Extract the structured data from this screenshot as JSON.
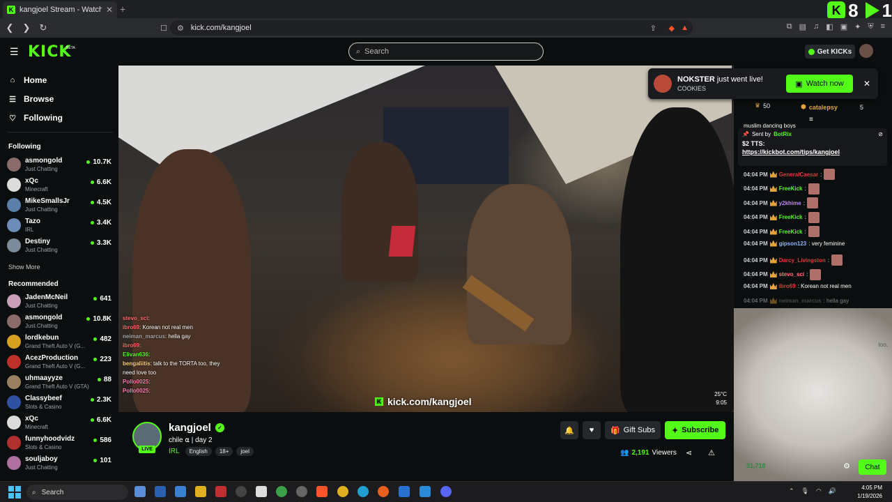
{
  "browser": {
    "tab_title": "kangjoel Stream - Watch Live",
    "tab_close": "✕",
    "new_tab": "+",
    "url": "kick.com/kangjoel",
    "overlay_counter": [
      "8",
      "1"
    ]
  },
  "header": {
    "logo": "KICK",
    "beta": "BETA",
    "search_placeholder": "Search",
    "get_kicks": "Get KICKs"
  },
  "sidebar": {
    "nav": [
      {
        "label": "Home",
        "icon": "⌂"
      },
      {
        "label": "Browse",
        "icon": "☰"
      },
      {
        "label": "Following",
        "icon": "♡"
      }
    ],
    "following_title": "Following",
    "following": [
      {
        "name": "asmongold",
        "category": "Just Chatting",
        "viewers": "10.7K",
        "color": "#8b6a6a"
      },
      {
        "name": "xQc",
        "category": "Minecraft",
        "viewers": "6.6K",
        "color": "#dcdcdc"
      },
      {
        "name": "MikeSmallsJr",
        "category": "Just Chatting",
        "viewers": "4.5K",
        "color": "#5a7fa8"
      },
      {
        "name": "Tazo",
        "category": "IRL",
        "viewers": "3.4K",
        "color": "#6b8db8"
      },
      {
        "name": "Destiny",
        "category": "Just Chatting",
        "viewers": "3.3K",
        "color": "#7a8a99"
      }
    ],
    "show_more": "Show More",
    "recommended_title": "Recommended",
    "recommended": [
      {
        "name": "JadenMcNeil",
        "category": "Just Chatting",
        "viewers": "641",
        "color": "#c9a0b8"
      },
      {
        "name": "asmongold",
        "category": "Just Chatting",
        "viewers": "10.8K",
        "color": "#8b6a6a"
      },
      {
        "name": "lordkebun",
        "category": "Grand Theft Auto V (G...",
        "viewers": "482",
        "color": "#d6a020"
      },
      {
        "name": "AcezProduction",
        "category": "Grand Theft Auto V (G...",
        "viewers": "223",
        "color": "#c0302a"
      },
      {
        "name": "uhmaayyze",
        "category": "Grand Theft Auto V (GTA)",
        "viewers": "88",
        "color": "#9a8060"
      },
      {
        "name": "Classybeef",
        "category": "Slots & Casino",
        "viewers": "2.3K",
        "color": "#3050a0"
      },
      {
        "name": "xQc",
        "category": "Minecraft",
        "viewers": "6.6K",
        "color": "#dcdcdc"
      },
      {
        "name": "funnyhoodvidz",
        "category": "Slots & Casino",
        "viewers": "586",
        "color": "#b03030"
      },
      {
        "name": "souljaboy",
        "category": "Just Chatting",
        "viewers": "101",
        "color": "#b070a0"
      }
    ]
  },
  "video": {
    "watermark": "kick.com/kangjoel",
    "overlay_chat": [
      {
        "user": "stevo_sci",
        "text": ":",
        "color": "#ff6a6a"
      },
      {
        "user": "ibro69",
        "text": ": Korean not real men",
        "color": "#ff6a6a"
      },
      {
        "user": "neiman_marcus",
        "text": ": hella gay",
        "color": "#aaaaaa"
      },
      {
        "user": "ibro69",
        "text": ":",
        "color": "#ff6a6a"
      },
      {
        "user": "Elivan636",
        "text": ":",
        "color": "#53fc18"
      },
      {
        "user": "bengaliitis",
        "text": ": talk to the TORTA too, they",
        "color": "#ffd27a"
      },
      {
        "user": "",
        "text": "need love too",
        "color": "#ffffff"
      },
      {
        "user": "Pollo0025",
        "text": ":",
        "color": "#ff7ab0"
      },
      {
        "user": "Pollo0025",
        "text": ":",
        "color": "#ff7ab0"
      }
    ],
    "temp": "25°C",
    "time": "9:05"
  },
  "notification": {
    "name": "NOKSTER",
    "text": " just went live!",
    "category": "COOKIES",
    "button": "Watch now",
    "close": "✕"
  },
  "chat": {
    "top_users": [
      {
        "count": "50"
      },
      {
        "name": "catalepsy",
        "count": "5"
      }
    ],
    "partial_line": "muslim dancing boys",
    "pinned": {
      "sent_by": "Sent by",
      "bot": "BotRix",
      "line1": "$2 TTS:",
      "line2": "https://kickbot.com/tips/kangjoel"
    },
    "messages": [
      {
        "time": "04:04 PM",
        "user": "GeneralCaesar",
        "color": "#e03c3c",
        "text": ":",
        "emote": true
      },
      {
        "time": "04:04 PM",
        "user": "FreeKick",
        "color": "#53fc18",
        "text": ":",
        "emote": true
      },
      {
        "time": "04:04 PM",
        "user": "y2khime",
        "color": "#c084fc",
        "text": ":",
        "emote": true
      },
      {
        "time": "04:04 PM",
        "user": "FreeKick",
        "color": "#53fc18",
        "text": ":",
        "emote": true
      },
      {
        "time": "04:04 PM",
        "user": "FreeKick",
        "color": "#53fc18",
        "text": ":",
        "emote": true
      },
      {
        "time": "04:04 PM",
        "user": "gipson123",
        "color": "#8fb4ff",
        "text": ": very feminine",
        "emote": false
      },
      {
        "time": "04:04 PM",
        "user": "Darcy_Livingston",
        "color": "#e03c3c",
        "text": ":",
        "emote": true
      },
      {
        "time": "04:04 PM",
        "user": "stevo_sci",
        "color": "#ff7a7a",
        "text": ":",
        "emote": true
      },
      {
        "time": "04:04 PM",
        "user": "ibro69",
        "color": "#e03c3c",
        "text": ": Korean not real men",
        "emote": false
      },
      {
        "time": "04:04 PM",
        "user": "neiman_marcus",
        "color": "#8a8a8a",
        "text": ": hella gay",
        "emote": false
      }
    ],
    "partial_right": "too,",
    "viewer_count": "31,710",
    "chat_button": "Chat"
  },
  "stream": {
    "name": "kangjoel",
    "title": "chile ⍺ | day 2",
    "live": "LIVE",
    "category": "IRL",
    "tags": [
      "English",
      "18+",
      "joel"
    ],
    "gift_subs": "Gift Subs",
    "subscribe": "Subscribe",
    "viewers": "2,191",
    "viewers_label": "Viewers"
  },
  "taskbar": {
    "search": "Search",
    "time": "4:05 PM",
    "date": "1/19/2026"
  },
  "colors": {
    "accent": "#53fc18",
    "background": "#0b0e0f"
  }
}
